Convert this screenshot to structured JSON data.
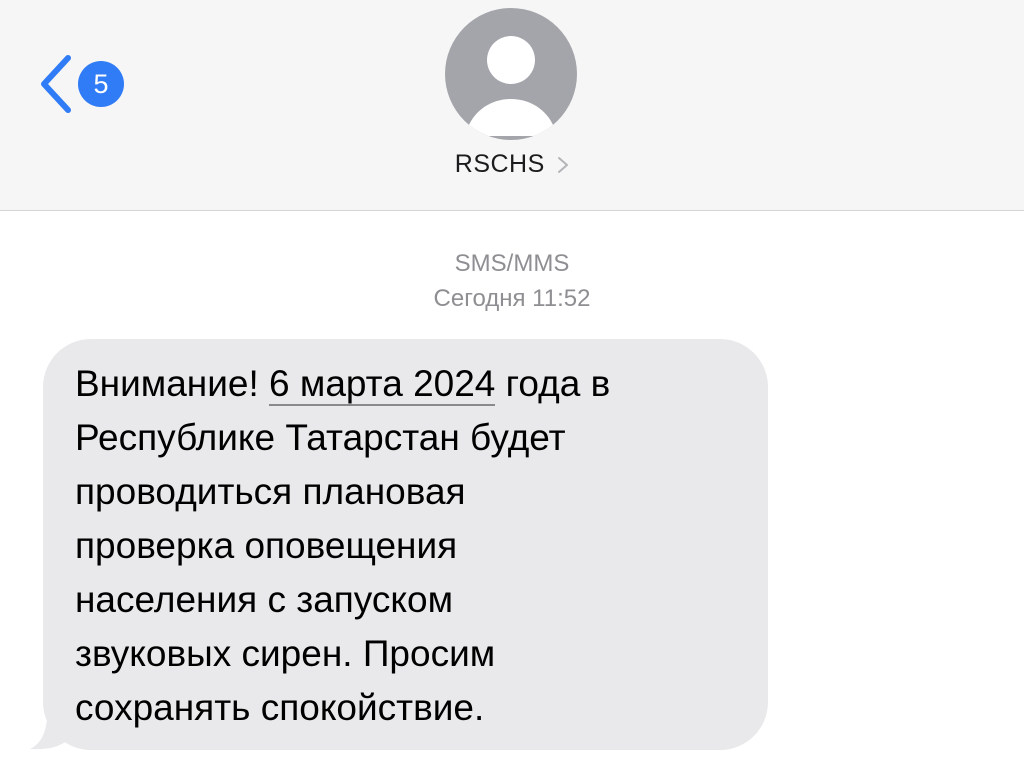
{
  "header": {
    "back_badge_count": "5",
    "contact_name": "RSCHS"
  },
  "thread": {
    "service_label": "SMS/MMS",
    "timestamp": "Сегодня 11:52"
  },
  "message": {
    "text_before": "Внимание! ",
    "date_link": "6 марта 2024",
    "text_after": " года в\nРеспублике Татарстан будет\nпроводиться плановая\nпроверка оповещения\nнаселения с запуском\nзвуковых сирен. Просим\nсохранять спокойствие."
  },
  "colors": {
    "accent": "#2f7cf6",
    "header_background": "#f6f6f6",
    "bubble_background": "#e9e9eb",
    "meta_text": "#8e8e93",
    "avatar_background": "#a4a5ab"
  },
  "icons": {
    "back": "chevron-left-icon",
    "avatar": "person-silhouette-icon",
    "disclosure": "chevron-right-icon"
  }
}
